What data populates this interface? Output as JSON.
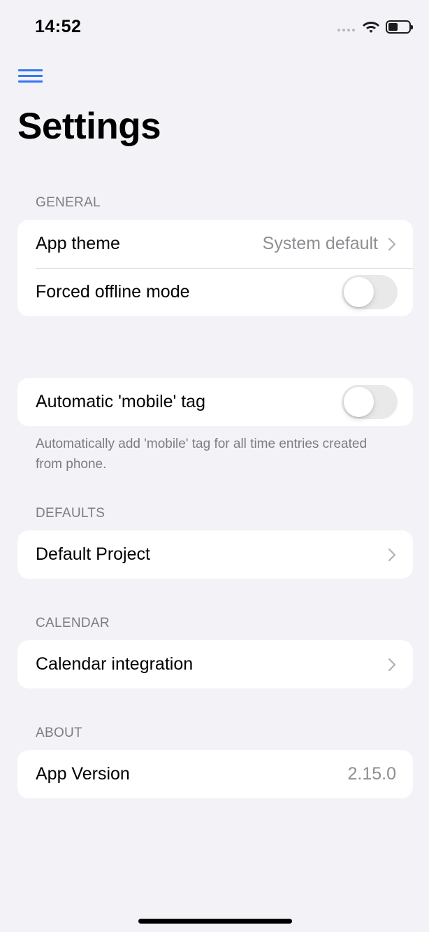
{
  "status_bar": {
    "time": "14:52"
  },
  "header": {
    "title": "Settings"
  },
  "sections": {
    "general": {
      "header": "GENERAL",
      "app_theme": {
        "label": "App theme",
        "value": "System default"
      },
      "offline_mode": {
        "label": "Forced offline mode",
        "enabled": false
      }
    },
    "mobile_tag": {
      "label": "Automatic 'mobile' tag",
      "enabled": false,
      "footer": "Automatically add 'mobile' tag for all time entries created from phone."
    },
    "defaults": {
      "header": "DEFAULTS",
      "default_project": {
        "label": "Default Project"
      }
    },
    "calendar": {
      "header": "CALENDAR",
      "integration": {
        "label": "Calendar integration"
      }
    },
    "about": {
      "header": "ABOUT",
      "app_version": {
        "label": "App Version",
        "value": "2.15.0"
      }
    }
  },
  "colors": {
    "accent": "#3478f6",
    "background": "#f2f2f7",
    "secondary_text": "#8e8e93",
    "toggle_off": "#e9e9ea"
  }
}
